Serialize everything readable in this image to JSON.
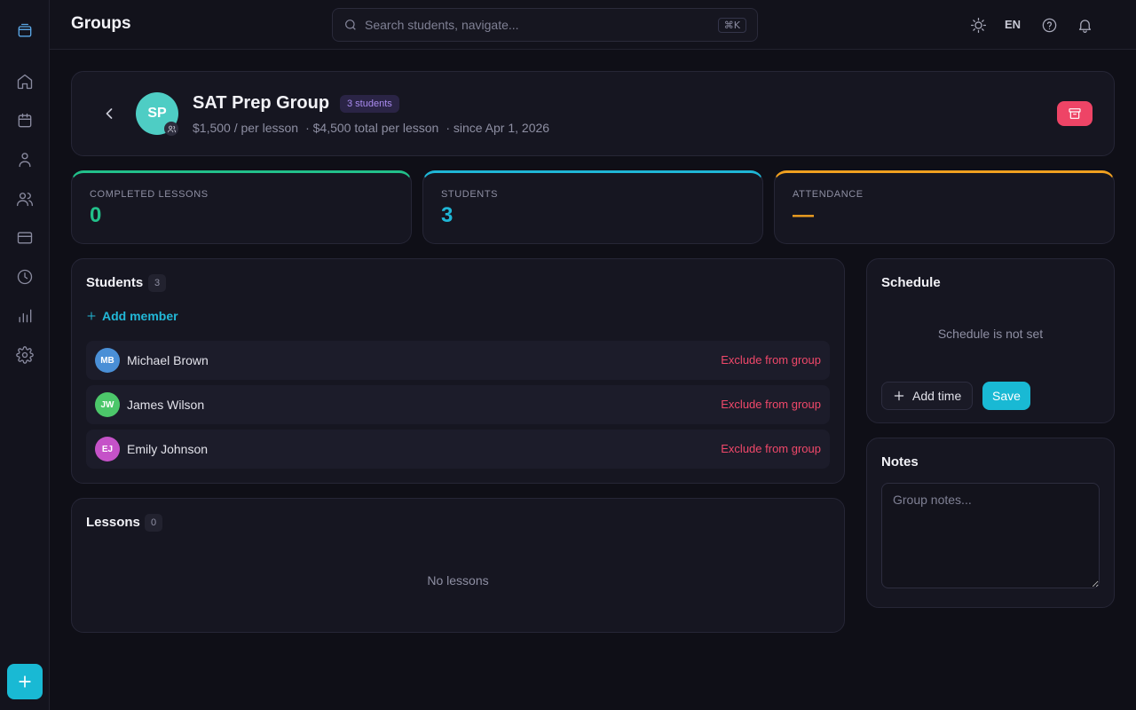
{
  "header": {
    "title": "Groups",
    "search_placeholder": "Search students, navigate...",
    "search_shortcut": "⌘K",
    "language": "EN"
  },
  "sidebar": {
    "items": [
      {
        "name": "dashboard",
        "icon": "home-icon"
      },
      {
        "name": "calendar",
        "icon": "calendar-icon"
      },
      {
        "name": "students",
        "icon": "user-icon"
      },
      {
        "name": "groups",
        "icon": "users-icon"
      },
      {
        "name": "payments",
        "icon": "card-icon"
      },
      {
        "name": "history",
        "icon": "clock-icon"
      },
      {
        "name": "reports",
        "icon": "bar-chart-icon"
      },
      {
        "name": "settings",
        "icon": "gear-icon"
      }
    ]
  },
  "group": {
    "initials": "SP",
    "name": "SAT Prep Group",
    "student_count_label": "3 students",
    "price": "$1,500 / per lesson",
    "total": "· $4,500 total per lesson",
    "since": "· since Apr 1, 2026"
  },
  "stats": [
    {
      "label": "COMPLETED LESSONS",
      "value": "0",
      "color": "#22c08a"
    },
    {
      "label": "STUDENTS",
      "value": "3",
      "color": "#1fb6d6"
    },
    {
      "label": "ATTENDANCE",
      "value": "—",
      "color": "#f0a020"
    }
  ],
  "students_section": {
    "title": "Students",
    "count": "3",
    "add_label": "Add member",
    "exclude_label": "Exclude from group",
    "members": [
      {
        "initials": "MB",
        "name": "Michael Brown",
        "color": "#4a8fd6"
      },
      {
        "initials": "JW",
        "name": "James Wilson",
        "color": "#4cc76a"
      },
      {
        "initials": "EJ",
        "name": "Emily Johnson",
        "color": "#c552c8"
      }
    ]
  },
  "lessons_section": {
    "title": "Lessons",
    "count": "0",
    "empty": "No lessons"
  },
  "schedule_section": {
    "title": "Schedule",
    "empty": "Schedule is not set",
    "add_time_label": "Add time",
    "save_label": "Save"
  },
  "notes_section": {
    "title": "Notes",
    "placeholder": "Group notes..."
  },
  "colors": {
    "accent": "#19b9d4",
    "danger": "#ee4466",
    "badge_purple": "#a98bf0"
  }
}
